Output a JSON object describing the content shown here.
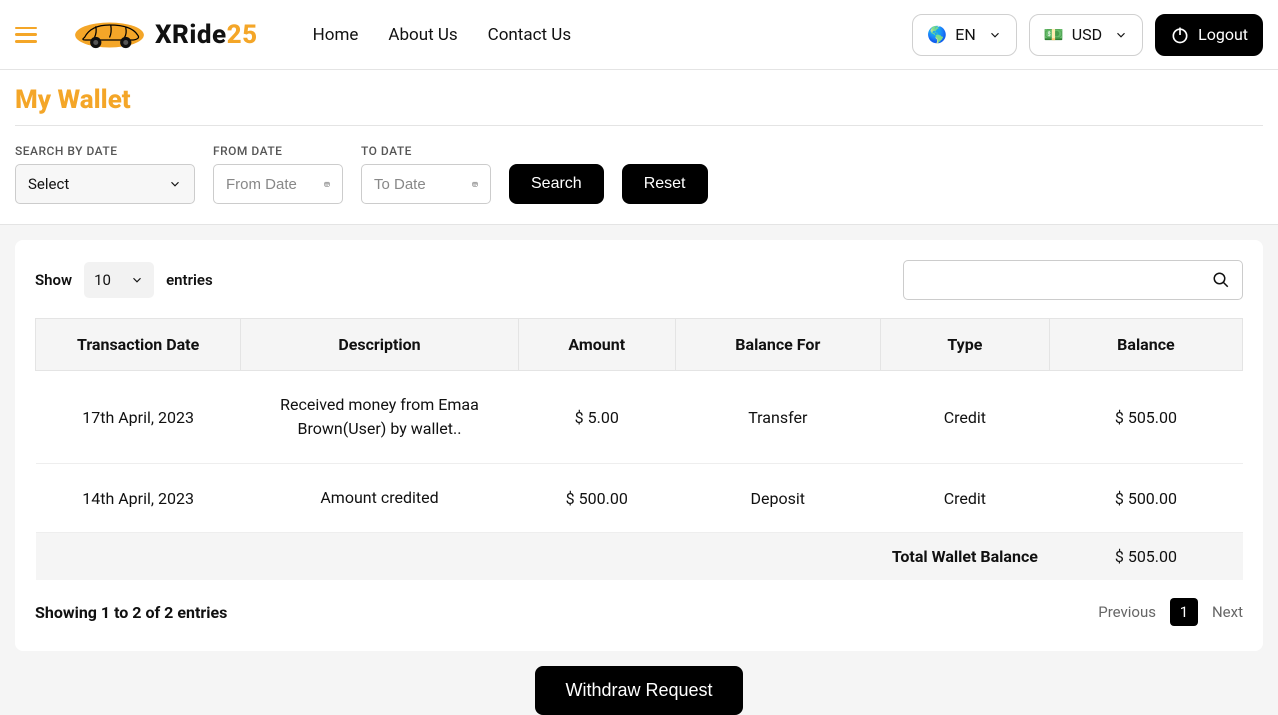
{
  "brand": {
    "name_main": "XRide",
    "name_accent": "25"
  },
  "nav": {
    "home": "Home",
    "about": "About Us",
    "contact": "Contact Us"
  },
  "lang_selector": {
    "flag": "🌎",
    "code": "EN"
  },
  "currency_selector": {
    "icon": "💵",
    "code": "USD"
  },
  "logout_label": "Logout",
  "page_title": "My Wallet",
  "filters": {
    "search_by_date_label": "SEARCH BY DATE",
    "search_by_date_selected": "Select",
    "from_date_label": "FROM DATE",
    "from_date_placeholder": "From Date",
    "to_date_label": "TO DATE",
    "to_date_placeholder": "To Date",
    "search_btn": "Search",
    "reset_btn": "Reset"
  },
  "table_controls": {
    "show_label": "Show",
    "entries_selected": "10",
    "entries_label": "entries"
  },
  "columns": {
    "date": "Transaction Date",
    "description": "Description",
    "amount": "Amount",
    "balance_for": "Balance For",
    "type": "Type",
    "balance": "Balance"
  },
  "rows": [
    {
      "date": "17th April, 2023",
      "description": "Received money from Emaa Brown(User) by wallet..",
      "amount": "$ 5.00",
      "balance_for": "Transfer",
      "type": "Credit",
      "balance": "$ 505.00"
    },
    {
      "date": "14th April, 2023",
      "description": "Amount credited",
      "amount": "$ 500.00",
      "balance_for": "Deposit",
      "type": "Credit",
      "balance": "$ 500.00"
    }
  ],
  "total": {
    "label": "Total Wallet Balance",
    "value": "$ 505.00"
  },
  "showing_info": "Showing 1 to 2 of 2 entries",
  "pagination": {
    "prev": "Previous",
    "page": "1",
    "next": "Next"
  },
  "withdraw_btn": "Withdraw Request"
}
